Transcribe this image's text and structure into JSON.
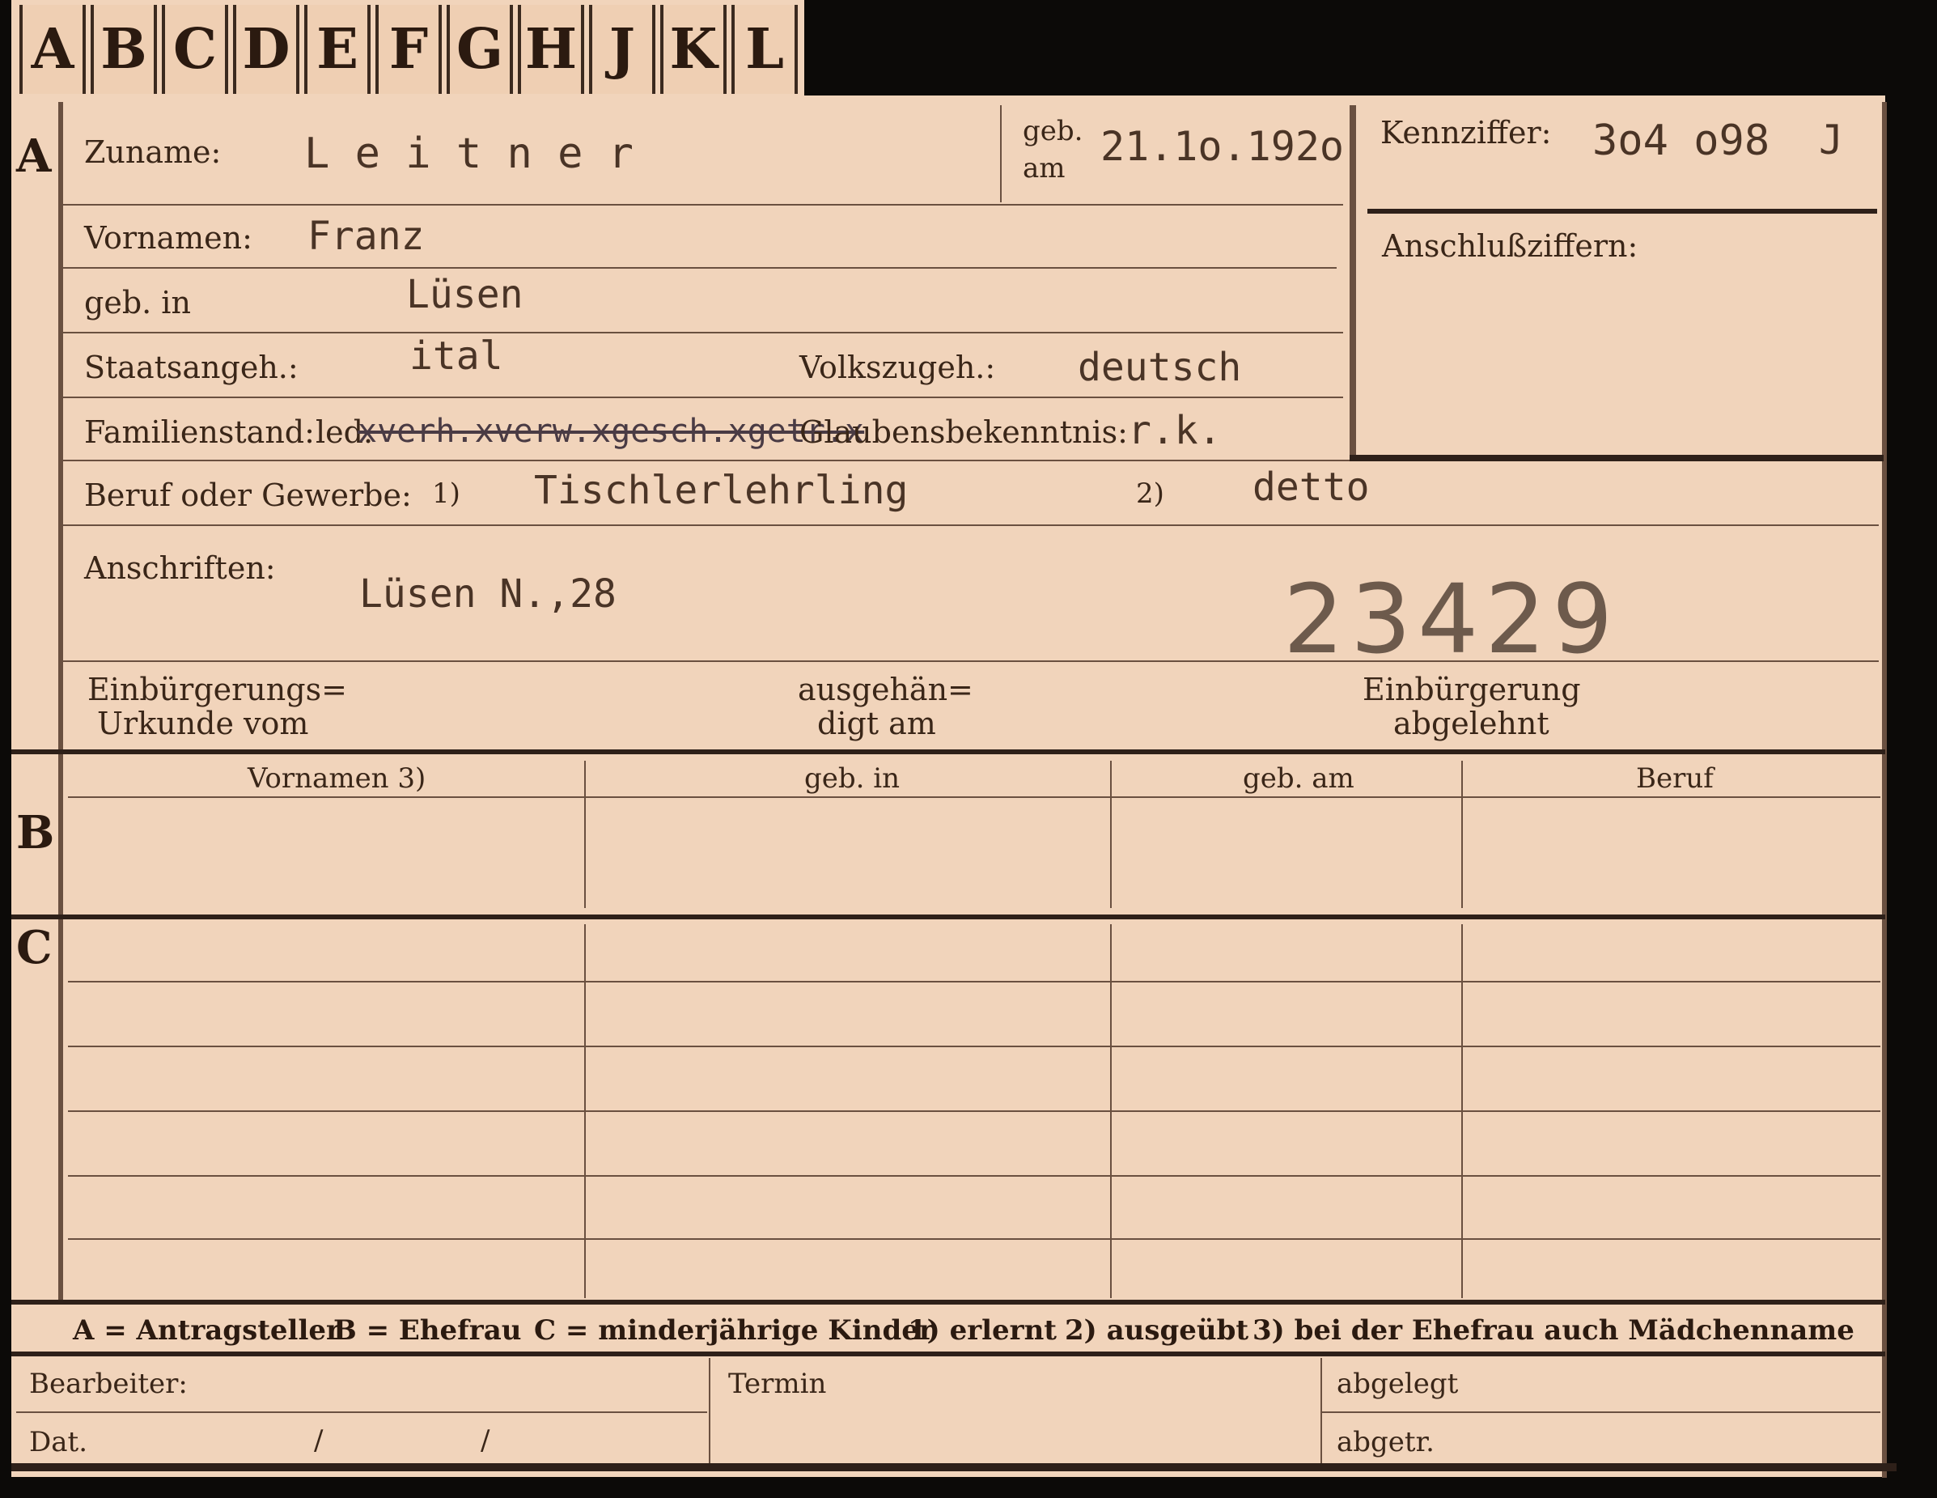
{
  "tabs": [
    "A",
    "B",
    "C",
    "D",
    "E",
    "F",
    "G",
    "H",
    "J",
    "K",
    "L"
  ],
  "sections": {
    "a": "A",
    "b": "B",
    "c": "C"
  },
  "header": {
    "surname_label": "Zuname:",
    "surname_value": "L e i t n e r",
    "birth_date_label_1": "geb.",
    "birth_date_label_2": "am",
    "birth_date_value": "21.1o.192o",
    "id_label": "Kennziffer:",
    "id_value": "3o4 o98",
    "id_suffix": "J",
    "related_ids_label": "Anschlußziffern:"
  },
  "fields": {
    "firstname_label": "Vornamen:",
    "firstname_value": "Franz",
    "birthplace_label": "geb. in",
    "birthplace_value": "Lüsen",
    "citizenship_label": "Staatsangeh.:",
    "citizenship_value": "ital",
    "ethnicity_label": "Volkszugeh.:",
    "ethnicity_value": "deutsch",
    "marital_label": "Familienstand:",
    "marital_value": "led.",
    "marital_struck": "xverh.xverw.xgesch.xgetr.x",
    "religion_label": "Glaubensbekenntnis:",
    "religion_value": "r.k.",
    "profession_label": "Beruf oder Gewerbe:",
    "profession_note1": "1)",
    "profession_value1": "Tischlerlehrling",
    "profession_note2": "2)",
    "profession_value2": "detto",
    "address_label": "Anschriften:",
    "address_value": "Lüsen N.,28",
    "stamp_number": "23429",
    "naturalization_label_1": "Einbürgerungs=",
    "naturalization_label_2": "Urkunde vom",
    "handed_label_1": "ausgehän=",
    "handed_label_2": "digt am",
    "rejected_label_1": "Einbürgerung",
    "rejected_label_2": "abgelehnt"
  },
  "table_b": {
    "headers": [
      "Vornamen 3)",
      "geb. in",
      "geb. am",
      "Beruf"
    ]
  },
  "legend": {
    "a": "A = Antragsteller",
    "b": "B = Ehefrau",
    "c": "C = minderjährige Kinder",
    "n1": "1) erlernt",
    "n2": "2) ausgeübt",
    "n3": "3) bei der Ehefrau auch Mädchenname"
  },
  "footer": {
    "clerk_label": "Bearbeiter:",
    "date_label": "Dat.",
    "date_sep1": "/",
    "date_sep2": "/",
    "deadline_label": "Termin",
    "filed_label": "abgelegt",
    "removed_label": "abgetr."
  }
}
